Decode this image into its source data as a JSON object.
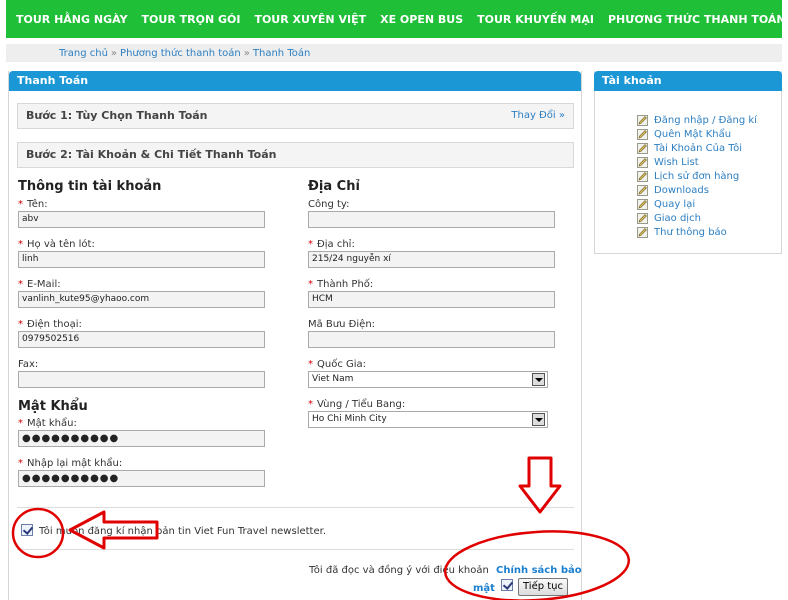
{
  "topnav": {
    "items": [
      "TOUR HẰNG NGÀY",
      "TOUR TRỌN GÓI",
      "TOUR XUYÊN VIỆT",
      "XE OPEN BUS",
      "TOUR KHUYẾN MẠI",
      "PHƯƠNG THỨC THANH TOÁN"
    ]
  },
  "breadcrumb": {
    "items": [
      "Trang chủ",
      "Phương thức thanh toán",
      "Thanh Toán"
    ],
    "separator": "»"
  },
  "main": {
    "title": "Thanh Toán",
    "step1": {
      "label": "Bước 1: Tùy Chọn Thanh Toán",
      "change": "Thay Đổi »"
    },
    "step2": {
      "label": "Bước 2: Tài Khoản & Chi Tiết Thanh Toán"
    },
    "account": {
      "title": "Thông tin tài khoản",
      "first_name": {
        "label": "Tên:",
        "value": "abv"
      },
      "last_name": {
        "label": "Họ và tên lót:",
        "value": "linh"
      },
      "email": {
        "label": "E-Mail:",
        "value": "vanlinh_kute95@yhaoo.com"
      },
      "phone": {
        "label": "Điện thoại:",
        "value": "0979502516"
      },
      "fax": {
        "label": "Fax:",
        "value": ""
      }
    },
    "password": {
      "title": "Mật Khẩu",
      "password": {
        "label": "Mật khẩu:",
        "value": "●●●●●●●●●●"
      },
      "confirm": {
        "label": "Nhập lại mật khẩu:",
        "value": "●●●●●●●●●●"
      }
    },
    "address": {
      "title": "Địa Chỉ",
      "company": {
        "label": "Công ty:",
        "value": ""
      },
      "address1": {
        "label": "Địa chỉ:",
        "value": "215/24 nguyễn xí"
      },
      "city": {
        "label": "Thành Phố:",
        "value": "HCM"
      },
      "postcode": {
        "label": "Mã Bưu Điện:",
        "value": ""
      },
      "country": {
        "label": "Quốc Gia:",
        "value": "Viet Nam"
      },
      "zone": {
        "label": "Vùng / Tiểu Bang:",
        "value": "Ho Chi Minh City"
      }
    },
    "newsletter": {
      "label": "Tôi muốn đăng kí nhận bản tin Viet Fun Travel newsletter.",
      "checked": true
    },
    "agree": {
      "text": "Tôi đã đọc và đồng ý với điều khoản",
      "link_line1": "Chính sách bảo",
      "link_line2": "mật",
      "checked": true
    },
    "continue_label": "Tiếp tục"
  },
  "sidebar": {
    "title": "Tài khoản",
    "items": [
      "Đăng nhập / Đăng kí",
      "Quên Mật Khẩu",
      "Tài Khoản Của Tôi",
      "Wish List",
      "Lịch sử đơn hàng",
      "Downloads",
      "Quay lại",
      "Giao dịch",
      "Thư thông báo"
    ]
  },
  "colors": {
    "nav_green": "#1fbf37",
    "panel_blue": "#1b97d6",
    "link_blue": "#2d7fc2",
    "required_red": "#d00000",
    "annotation_red": "#e00000"
  }
}
